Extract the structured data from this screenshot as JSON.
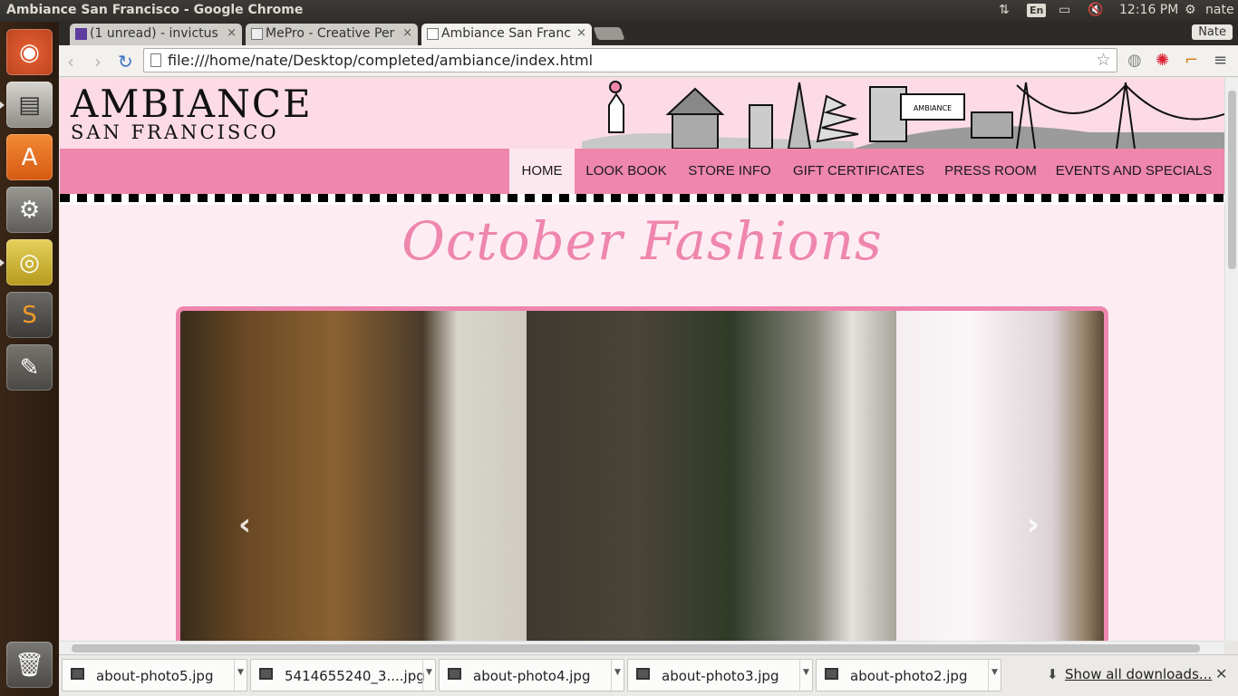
{
  "panel": {
    "window_title": "Ambiance San Francisco - Google Chrome",
    "keyboard": "En",
    "time": "12:16 PM",
    "user": "nate"
  },
  "launcher": [
    "ubuntu-dash",
    "files",
    "software-center",
    "system-settings",
    "chrome",
    "sublime-text",
    "gimp",
    "trash"
  ],
  "tabs": [
    {
      "label": "(1 unread) - invictus",
      "icon": "mail-icon"
    },
    {
      "label": "MePro - Creative Per",
      "icon": "mepro-icon"
    },
    {
      "label": "Ambiance San Franc",
      "icon": "page-icon"
    }
  ],
  "profile_label": "Nate",
  "address": "file:///home/nate/Desktop/completed/ambiance/index.html",
  "site": {
    "logo_main": "AMBIANCE",
    "logo_sub": "SAN FRANCISCO",
    "store_sign": "AMBIANCE",
    "nav": [
      {
        "label": "HOME",
        "active": true
      },
      {
        "label": "LOOK BOOK",
        "active": false
      },
      {
        "label": "STORE INFO",
        "active": false
      },
      {
        "label": "GIFT CERTIFICATES",
        "active": false
      },
      {
        "label": "PRESS ROOM",
        "active": false
      },
      {
        "label": "EVENTS AND SPECIALS",
        "active": false
      }
    ],
    "headline": "October Fashions",
    "carousel": {
      "prev": "‹",
      "next": "›"
    }
  },
  "downloads": [
    {
      "name": "about-photo5.jpg"
    },
    {
      "name": "5414655240_3....jpg"
    },
    {
      "name": "about-photo4.jpg"
    },
    {
      "name": "about-photo3.jpg"
    },
    {
      "name": "about-photo2.jpg"
    }
  ],
  "show_all": "Show all downloads...",
  "colors": {
    "brand_pink": "#ee86ae",
    "header_pink": "#fcdbe6",
    "page_bg": "#fdecf2"
  }
}
